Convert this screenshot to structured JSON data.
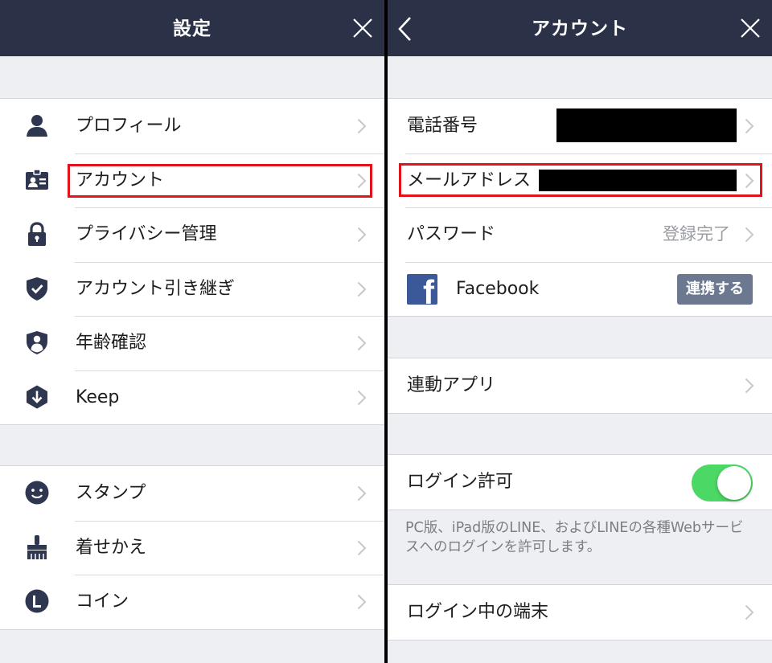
{
  "left": {
    "title": "設定",
    "group1": [
      {
        "label": "プロフィール",
        "icon": "person-icon"
      },
      {
        "label": "アカウント",
        "icon": "id-card-icon"
      },
      {
        "label": "プライバシー管理",
        "icon": "lock-icon"
      },
      {
        "label": "アカウント引き継ぎ",
        "icon": "shield-check-icon"
      },
      {
        "label": "年齢確認",
        "icon": "shield-person-icon"
      },
      {
        "label": "Keep",
        "icon": "keep-download-icon"
      }
    ],
    "group2": [
      {
        "label": "スタンプ",
        "icon": "smiley-icon"
      },
      {
        "label": "着せかえ",
        "icon": "brush-icon"
      },
      {
        "label": "コイン",
        "icon": "coin-icon"
      }
    ]
  },
  "right": {
    "title": "アカウント",
    "group1": [
      {
        "label": "電話番号"
      },
      {
        "label": "メールアドレス"
      },
      {
        "label": "パスワード",
        "value": "登録完了"
      },
      {
        "label": "Facebook",
        "button": "連携する"
      }
    ],
    "linked_apps": "連動アプリ",
    "login_allow": {
      "label": "ログイン許可",
      "enabled": true
    },
    "login_note": "PC版、iPad版のLINE、およびLINEの各種Webサービスへのログインを許可します。",
    "logged_in_devices": "ログイン中の端末"
  },
  "colors": {
    "navbar": "#2b3248",
    "highlight": "#e0121c",
    "toggle_on": "#4cd864",
    "facebook": "#3b5998",
    "icon": "#2e3650"
  }
}
